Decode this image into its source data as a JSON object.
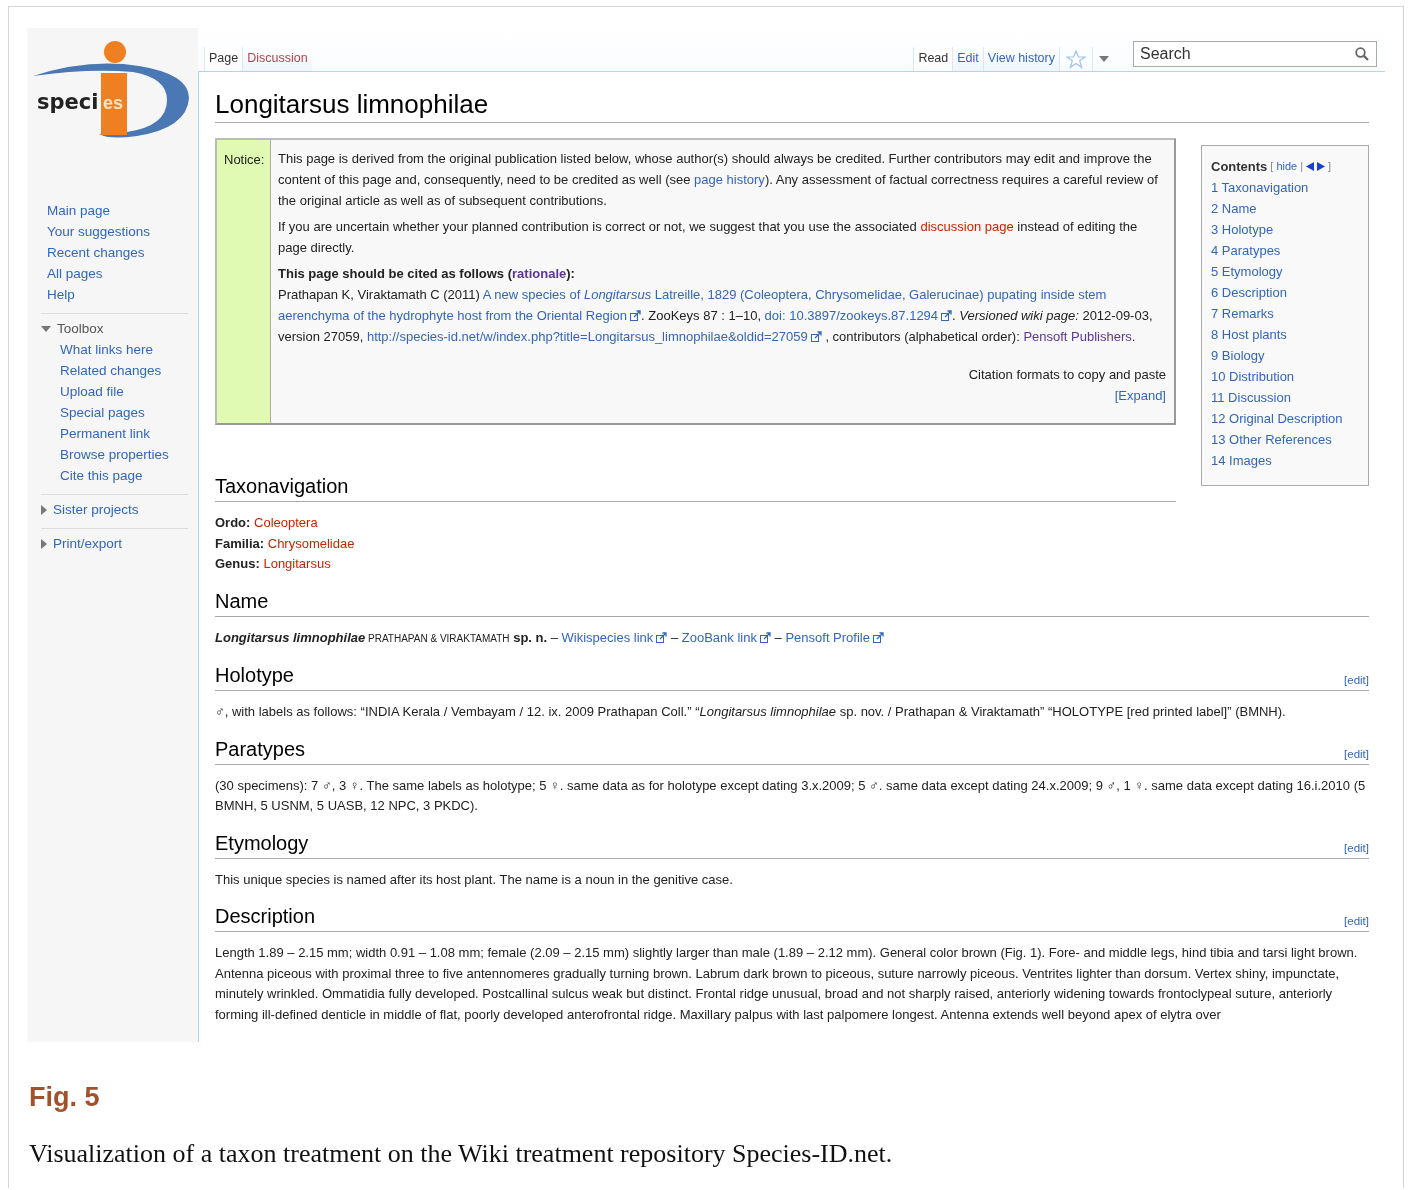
{
  "logo": {
    "text_dark": "speci",
    "text_light": "es"
  },
  "sidebar": {
    "links": [
      "Main page",
      "Your suggestions",
      "Recent changes",
      "All pages",
      "Help"
    ],
    "portlets": [
      {
        "label": "Toolbox",
        "expanded": true,
        "items": [
          "What links here",
          "Related changes",
          "Upload file",
          "Special pages",
          "Permanent link",
          "Browse properties",
          "Cite this page"
        ]
      },
      {
        "label": "Sister projects",
        "expanded": false
      },
      {
        "label": "Print/export",
        "expanded": false
      }
    ]
  },
  "page_tabs": [
    {
      "label": "Page",
      "selected": true,
      "missing": false
    },
    {
      "label": "Discussion",
      "selected": false,
      "missing": true
    }
  ],
  "view_tabs": [
    {
      "label": "Read",
      "selected": true
    },
    {
      "label": "Edit",
      "selected": false
    },
    {
      "label": "View history",
      "selected": false
    }
  ],
  "search": {
    "placeholder": "Search"
  },
  "title": "Longitarsus limnophilae",
  "notice": {
    "label": "Notice:",
    "paragraphs": [
      [
        {
          "kind": "text",
          "text": "This page is derived from the original publication listed below, whose author(s) should always be credited. Further contributors may edit and improve the content of this page and, consequently, need to be credited as well (see "
        },
        {
          "kind": "link",
          "text": "page history"
        },
        {
          "kind": "text",
          "text": "). Any assessment of factual correctness requires a careful review of the original article as well as of subsequent contributions."
        }
      ],
      [
        {
          "kind": "text",
          "text": "If you are uncertain whether your planned contribution is correct or not, we suggest that you use the associated "
        },
        {
          "kind": "redlink",
          "text": "discussion page"
        },
        {
          "kind": "text",
          "text": " instead of editing the page directly."
        }
      ]
    ],
    "cite_heading": [
      {
        "kind": "text",
        "text": "This page should be cited as follows ("
      },
      {
        "kind": "visited",
        "text": "rationale"
      },
      {
        "kind": "text",
        "text": "):"
      }
    ],
    "citation": [
      {
        "kind": "text",
        "text": "Prathapan K, Viraktamath C (2011) "
      },
      {
        "kind": "link",
        "text": "A new species of *Longitarsus* Latreille, 1829 (Coleoptera, Chrysomelidae, Galerucinae) pupating inside stem "
      },
      {
        "kind": "extlink",
        "text": "aerenchyma of the hydrophyte host from the Oriental Region"
      },
      {
        "kind": "text",
        "text": ". ZooKeys 87 : 1–10, "
      },
      {
        "kind": "extlink",
        "text": "doi: 10.3897/zookeys.87.1294"
      },
      {
        "kind": "text",
        "text": ". *Versioned wiki page:* 2012-09-03, version 27059, "
      },
      {
        "kind": "extlink",
        "text": "http://species-id.net/w/index.php?title=Longitarsus_limnophilae&oldid=27059"
      },
      {
        "kind": "text",
        "text": " , contributors (alphabetical order): "
      },
      {
        "kind": "visited",
        "text": "Pensoft Publishers"
      },
      {
        "kind": "text",
        "text": "."
      }
    ],
    "formats": "Citation formats to copy and paste",
    "expand": "[Expand]"
  },
  "toc": {
    "title": "Contents",
    "bracket_open": "[",
    "hide": "hide",
    "separator": "|",
    "bracket_close": "]",
    "items": [
      "1 Taxonavigation",
      "2 Name",
      "3 Holotype",
      "4 Paratypes",
      "5 Etymology",
      "6 Description",
      "7 Remarks",
      "8 Host plants",
      "9 Biology",
      "10 Distribution",
      "11 Discussion",
      "12 Original Description",
      "13 Other References",
      "14 Images"
    ]
  },
  "sections": [
    {
      "heading": "Taxonavigation",
      "kind": "taxonomy",
      "rows": [
        {
          "rank": "Ordo:",
          "name": "Coleoptera"
        },
        {
          "rank": "Familia:",
          "name": "Chrysomelidae"
        },
        {
          "rank": "Genus:",
          "name": "Longitarsus"
        }
      ]
    },
    {
      "heading": "Name",
      "kind": "parts",
      "parts": [
        {
          "kind": "name",
          "text": "Longitarsus limnophilae"
        },
        {
          "kind": "smallcaps",
          "text": " PRATHAPAN & VIRAKTAMATH"
        },
        {
          "kind": "text",
          "text": " **sp. n.** – "
        },
        {
          "kind": "extlink",
          "text": "Wikispecies link"
        },
        {
          "kind": "text",
          "text": " – "
        },
        {
          "kind": "extlink",
          "text": "ZooBank link"
        },
        {
          "kind": "text",
          "text": " – "
        },
        {
          "kind": "extlink",
          "text": "Pensoft Profile"
        }
      ]
    },
    {
      "heading": "Holotype",
      "edit": "[edit]",
      "kind": "text",
      "text": "♂, with labels as follows: “INDIA Kerala / Vembayam / 12. ix. 2009 Prathapan Coll.” “*Longitarsus limnophilae* sp. nov. / Prathapan & Viraktamath” “HOLOTYPE [red printed label]” (BMNH)."
    },
    {
      "heading": "Paratypes",
      "edit": "[edit]",
      "kind": "text",
      "text": "(30 specimens): 7 ♂, 3 ♀. The same labels as holotype; 5 ♀. same data as for holotype except dating 3.x.2009; 5 ♂. same data except dating 24.x.2009; 9 ♂, 1 ♀. same data except dating 16.i.2010 (5 BMNH, 5 USNM, 5 UASB, 12 NPC, 3 PKDC)."
    },
    {
      "heading": "Etymology",
      "edit": "[edit]",
      "kind": "text",
      "text": "This unique species is named after its host plant. The name is a noun in the genitive case."
    },
    {
      "heading": "Description",
      "edit": "[edit]",
      "kind": "text",
      "text": "Length 1.89 – 2.15 mm; width 0.91 – 1.08 mm; female (2.09 – 2.15 mm) slightly larger than male (1.89 – 2.12 mm). General color brown (Fig. 1). Fore- and middle legs, hind tibia and tarsi light brown. Antenna piceous with proximal three to five antennomeres gradually turning brown. Labrum dark brown to piceous, suture narrowly piceous. Ventrites lighter than dorsum. Vertex shiny, impunctate, minutely wrinkled. Ommatidia fully developed. Postcallinal sulcus weak but distinct. Frontal ridge unusual, broad and not sharply raised, anteriorly widening towards frontoclypeal suture, anteriorly forming ill-defined denticle in middle of flat, poorly developed anterofrontal ridge. Maxillary palpus with last palpomere longest. Antenna extends well beyond apex of elytra over"
    }
  ],
  "figure": {
    "label": "Fig. 5",
    "caption": "Visualization of a taxon treatment on the Wiki treatment repository Species-ID.net."
  }
}
